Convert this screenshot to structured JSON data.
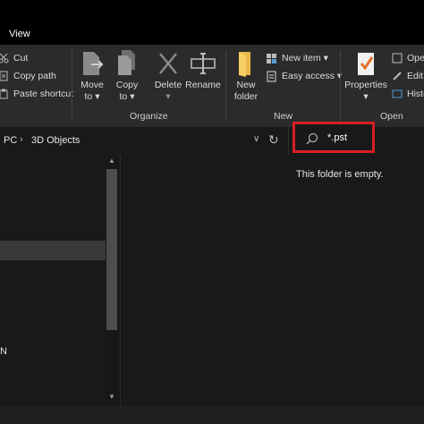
{
  "ribbon": {
    "tab_view": "View",
    "clipboard": {
      "cut": "Cut",
      "copy_path": "Copy path",
      "paste_shortcut": "Paste shortcut"
    },
    "organize": {
      "move_to_1": "Move",
      "move_to_2": "to ▾",
      "copy_to_1": "Copy",
      "copy_to_2": "to ▾",
      "delete_1": "Delete",
      "delete_2": "▾",
      "rename": "Rename",
      "label": "Organize"
    },
    "new": {
      "new_folder_1": "New",
      "new_folder_2": "folder",
      "new_item": "New item ▾",
      "easy_access": "Easy access ▾",
      "label": "New"
    },
    "open": {
      "properties": "Properties",
      "properties_arrow": "▾",
      "open": "Open",
      "edit": "Edit",
      "history": "History",
      "label": "Open"
    }
  },
  "address": {
    "crumb_pc": "PC",
    "crumb_sep": "›",
    "crumb_folder": "3D Objects",
    "chevron": "∨",
    "refresh": "↻"
  },
  "search": {
    "value": "*.pst"
  },
  "nav": {
    "partial_letter": "N"
  },
  "scroll": {
    "up": "▲",
    "down": "▼"
  },
  "content": {
    "empty_message": "This folder is empty."
  },
  "colors": {
    "search_highlight": "#d61f26",
    "background": "#191919",
    "ribbon": "#2b2b2b"
  }
}
